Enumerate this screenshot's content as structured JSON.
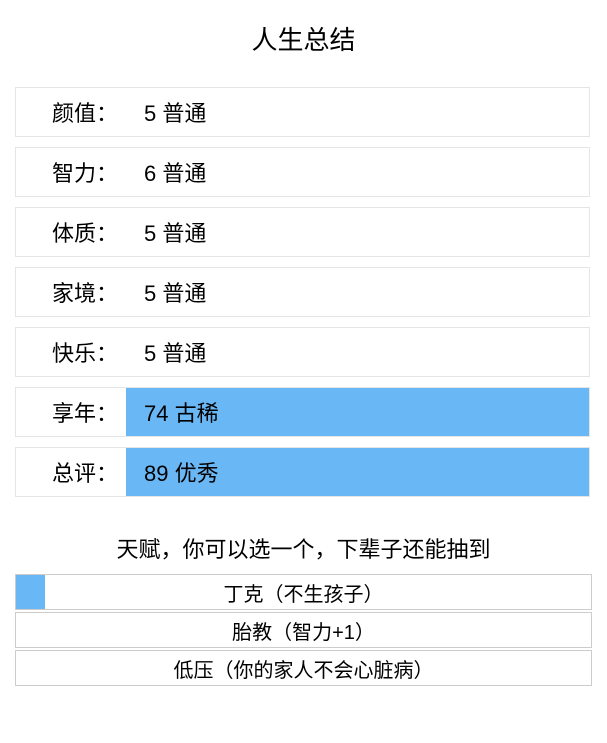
{
  "title": "人生总结",
  "stats": [
    {
      "label": "颜值：",
      "value": "5 普通",
      "highlight": false
    },
    {
      "label": "智力：",
      "value": "6 普通",
      "highlight": false
    },
    {
      "label": "体质：",
      "value": "5 普通",
      "highlight": false
    },
    {
      "label": "家境：",
      "value": "5 普通",
      "highlight": false
    },
    {
      "label": "快乐：",
      "value": "5 普通",
      "highlight": false
    },
    {
      "label": "享年：",
      "value": "74 古稀",
      "highlight": true
    },
    {
      "label": "总评：",
      "value": "89 优秀",
      "highlight": true
    }
  ],
  "talent": {
    "header": "天赋，你可以选一个，下辈子还能抽到",
    "items": [
      {
        "text": "丁克（不生孩子）",
        "progress": 5
      },
      {
        "text": "胎教（智力+1）",
        "progress": 0
      },
      {
        "text": "低压（你的家人不会心脏病）",
        "progress": 0
      }
    ]
  }
}
